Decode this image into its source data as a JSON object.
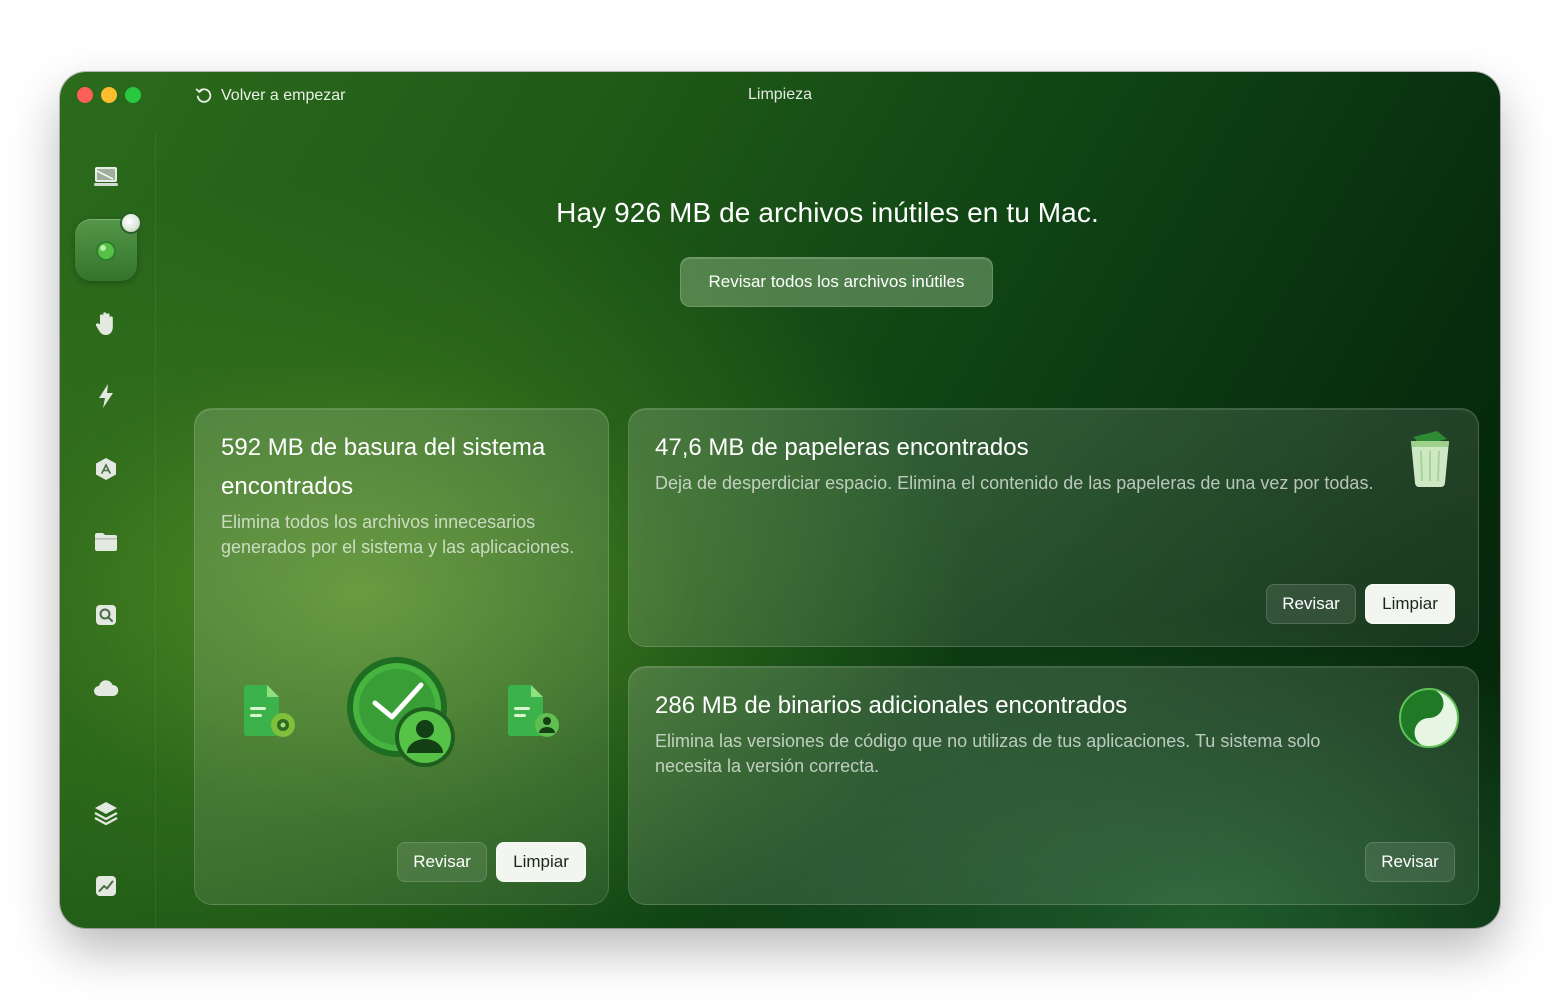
{
  "window": {
    "title": "Limpieza",
    "restart_label": "Volver a empezar"
  },
  "sidebar": {
    "items": [
      {
        "icon": "monitor-icon",
        "active": false
      },
      {
        "icon": "cleanup-icon",
        "active": true
      },
      {
        "icon": "hand-icon",
        "active": false
      },
      {
        "icon": "lightning-icon",
        "active": false
      },
      {
        "icon": "app-store-icon",
        "active": false
      },
      {
        "icon": "folder-icon",
        "active": false
      },
      {
        "icon": "disk-search-icon",
        "active": false
      },
      {
        "icon": "cloud-icon",
        "active": false
      },
      {
        "icon": "layers-icon",
        "active": false
      },
      {
        "icon": "chart-icon",
        "active": false
      }
    ]
  },
  "main": {
    "headline": "Hay 926 MB de archivos inútiles en tu Mac.",
    "review_all_label": "Revisar todos los archivos inútiles"
  },
  "cards": {
    "system": {
      "title_line1": "592 MB de basura del sistema",
      "title_line2": "encontrados",
      "description": "Elimina todos los archivos innecesarios generados por el sistema y las aplicaciones.",
      "review_label": "Revisar",
      "clean_label": "Limpiar"
    },
    "trash": {
      "title": "47,6 MB de papeleras encontrados",
      "description": "Deja de desperdiciar espacio. Elimina el contenido de las papeleras de una vez por todas.",
      "review_label": "Revisar",
      "clean_label": "Limpiar"
    },
    "binaries": {
      "title": "286 MB de binarios adicionales encontrados",
      "description": "Elimina las versiones de código que no utilizas de tus aplicaciones. Tu sistema solo necesita la versión correcta.",
      "review_label": "Revisar"
    }
  },
  "colors": {
    "accent_green": "#3da335",
    "traffic_red": "#fe5f57",
    "traffic_yellow": "#febc2e",
    "traffic_green": "#28c840"
  }
}
